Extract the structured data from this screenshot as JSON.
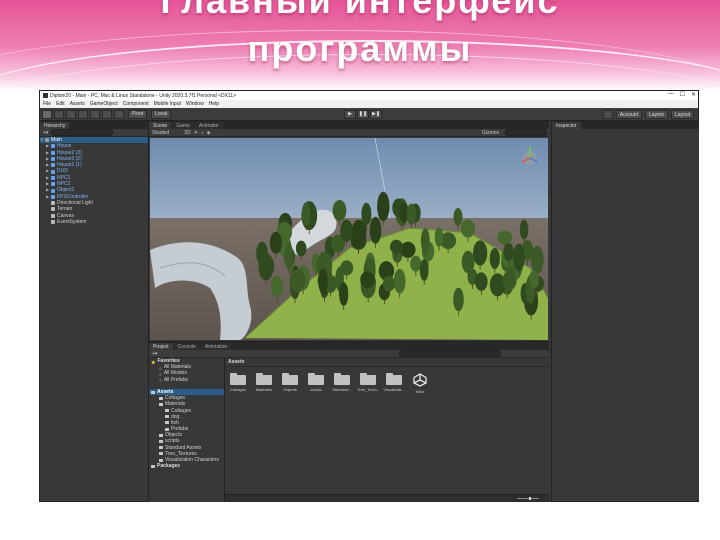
{
  "slide": {
    "title_line1": "Главный интерфейс",
    "title_line2": "программы"
  },
  "window": {
    "title": "Diplom20 - Main - PC, Mac & Linux Standalone - Unity 2020.3.7f1 Personal <DX11>",
    "controls": [
      "—",
      "☐",
      "✕"
    ]
  },
  "menu": [
    "File",
    "Edit",
    "Assets",
    "GameObject",
    "Component",
    "Mobile Input",
    "Window",
    "Help"
  ],
  "toolbar": {
    "pivot": "Pivot",
    "local": "Local",
    "play": "▶",
    "pause": "❚❚",
    "step": "▶❚",
    "account": "Account",
    "layers": "Layers",
    "layout": "Layout"
  },
  "hierarchy": {
    "tab": "Hierarchy",
    "scene": "Main",
    "items": [
      {
        "label": "House",
        "type": "prefab"
      },
      {
        "label": "House2 (3)",
        "type": "prefab"
      },
      {
        "label": "House2 (2)",
        "type": "prefab"
      },
      {
        "label": "House2 (1)",
        "type": "prefab"
      },
      {
        "label": "DUD",
        "type": "prefab"
      },
      {
        "label": "NPC1",
        "type": "prefab"
      },
      {
        "label": "NPC2",
        "type": "prefab"
      },
      {
        "label": "Object1",
        "type": "prefab"
      },
      {
        "label": "FPSController",
        "type": "prefab"
      },
      {
        "label": "Directional Light",
        "type": "obj"
      },
      {
        "label": "Terrain",
        "type": "obj"
      },
      {
        "label": "Canvas",
        "type": "obj"
      },
      {
        "label": "EventSystem",
        "type": "obj"
      }
    ]
  },
  "scene": {
    "tabs": [
      "Scene",
      "Game",
      "Animator"
    ],
    "shading": "Shaded",
    "mode": "2D",
    "gizmos": "Gizmos"
  },
  "inspector": {
    "tab": "Inspector"
  },
  "project": {
    "tabs": [
      "Project",
      "Console",
      "Animation"
    ],
    "breadcrumb": "Assets",
    "tree": [
      {
        "label": "Favorites",
        "kind": "star",
        "bold": true
      },
      {
        "label": "All Materials",
        "kind": "mag"
      },
      {
        "label": "All Models",
        "kind": "mag"
      },
      {
        "label": "All Prefabs",
        "kind": "mag"
      },
      {
        "label": "",
        "kind": "spacer"
      },
      {
        "label": "Assets",
        "kind": "folder",
        "bold": true,
        "selected": true
      },
      {
        "label": "Cottages",
        "kind": "folder"
      },
      {
        "label": "Materials",
        "kind": "folder"
      },
      {
        "label": "Cottages",
        "kind": "folder"
      },
      {
        "label": "dog",
        "kind": "folder"
      },
      {
        "label": "fish",
        "kind": "folder"
      },
      {
        "label": "Prefabs",
        "kind": "folder"
      },
      {
        "label": "Objects",
        "kind": "folder"
      },
      {
        "label": "scripts",
        "kind": "folder"
      },
      {
        "label": "Standard Assets",
        "kind": "folder"
      },
      {
        "label": "Tree_Textures",
        "kind": "folder"
      },
      {
        "label": "Visualization Characters",
        "kind": "folder"
      },
      {
        "label": "Packages",
        "kind": "folder",
        "bold": true
      }
    ],
    "assets": [
      {
        "label": "Cottages",
        "kind": "folder"
      },
      {
        "label": "Materials",
        "kind": "folder"
      },
      {
        "label": "Objects",
        "kind": "folder"
      },
      {
        "label": "scripts",
        "kind": "folder"
      },
      {
        "label": "Standard...",
        "kind": "folder"
      },
      {
        "label": "Tree_Textu...",
        "kind": "folder"
      },
      {
        "label": "Visualizati...",
        "kind": "folder"
      },
      {
        "label": "Main",
        "kind": "unity"
      }
    ]
  }
}
